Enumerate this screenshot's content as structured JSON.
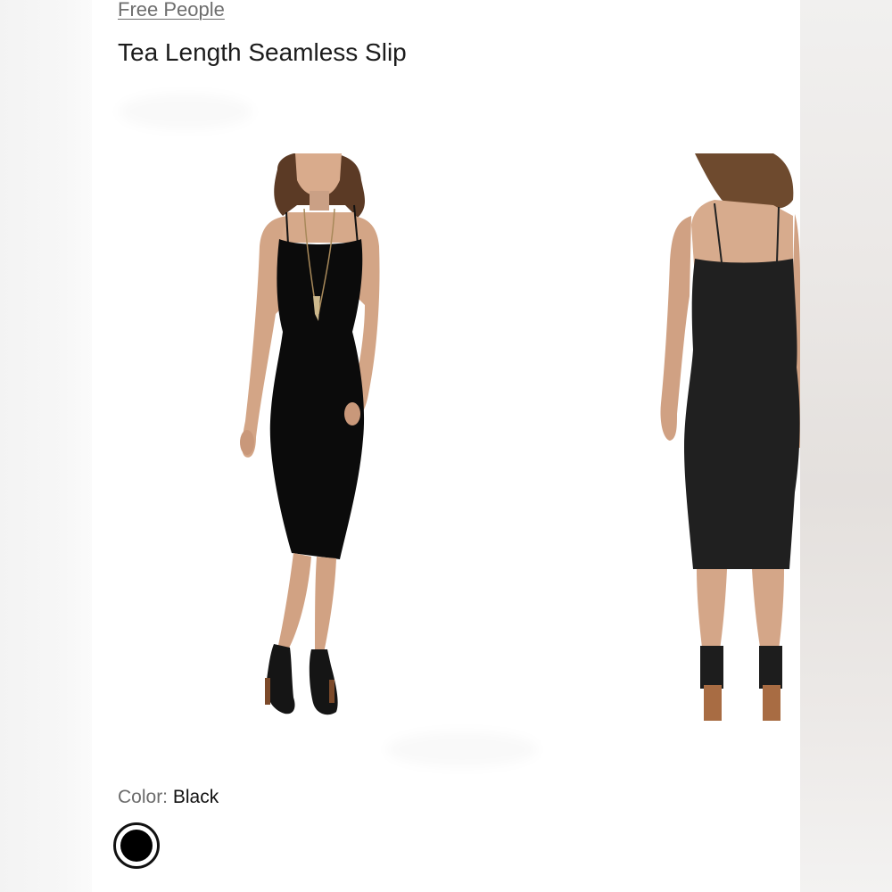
{
  "product": {
    "brand": "Free People",
    "title": "Tea Length Seamless Slip"
  },
  "gallery": {
    "images": [
      {
        "view": "front",
        "icon": "front-view-model-photo"
      },
      {
        "view": "back",
        "icon": "back-view-model-photo"
      }
    ]
  },
  "color": {
    "label": "Color:",
    "selected": "Black",
    "swatch_hex": "#000000"
  }
}
